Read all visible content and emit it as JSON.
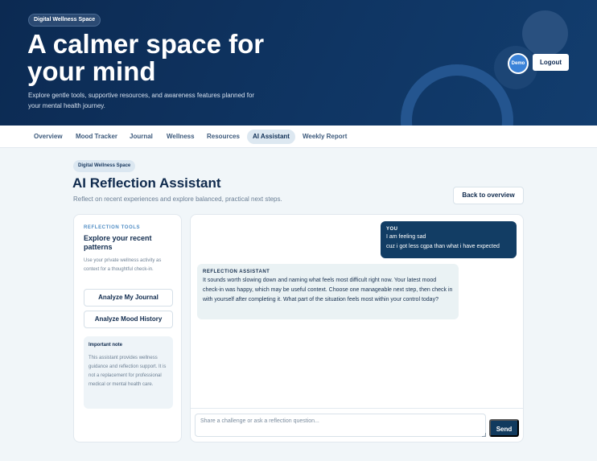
{
  "hero": {
    "badge": "Digital Wellness Space",
    "title": "A calmer space for your mind",
    "subtitle": "Explore gentle tools, supportive resources, and awareness features planned for your mental health journey.",
    "user_label": "Demo",
    "logout_label": "Logout"
  },
  "nav": {
    "items": [
      {
        "label": "Overview"
      },
      {
        "label": "Mood Tracker"
      },
      {
        "label": "Journal"
      },
      {
        "label": "Wellness"
      },
      {
        "label": "Resources"
      },
      {
        "label": "AI Assistant",
        "active": true
      },
      {
        "label": "Weekly Report"
      }
    ]
  },
  "page": {
    "badge": "Digital Wellness Space",
    "title": "AI Reflection Assistant",
    "subtitle": "Reflect on recent experiences and explore balanced, practical next steps.",
    "back_label": "Back to overview"
  },
  "tools": {
    "label": "REFLECTION TOOLS",
    "title": "Explore your recent patterns",
    "description": "Use your private wellness activity as context for a thoughtful check-in.",
    "analyze_journal": "Analyze My Journal",
    "analyze_mood": "Analyze Mood History",
    "note_title": "Important note",
    "note_text": "This assistant provides wellness guidance and reflection support. It is not a replacement for professional medical or mental health care."
  },
  "chat": {
    "messages": [
      {
        "sender": "YOU",
        "lines": [
          "I am feeling sad",
          "cuz i got less cgpa than what i have expected"
        ]
      },
      {
        "sender": "REFLECTION ASSISTANT",
        "text": "It sounds worth slowing down and naming what feels most difficult right now. Your latest mood check-in was happy, which may be useful context. Choose one manageable next step, then check in with yourself after completing it. What part of the situation feels most within your control today?"
      }
    ],
    "input_placeholder": "Share a challenge or ask a reflection question...",
    "send_label": "Send"
  },
  "colors": {
    "hero_bg": "#0c2a52",
    "accent": "#113a5e",
    "avatar": "#3a82d8",
    "page_bg": "#f1f6f9"
  }
}
